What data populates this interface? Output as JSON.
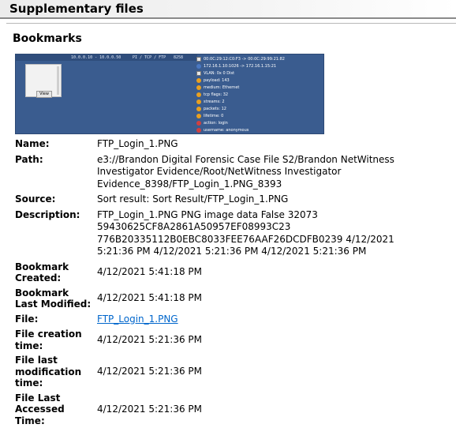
{
  "section": {
    "title": "Supplementary files"
  },
  "bookmarks": {
    "heading": "Bookmarks"
  },
  "thumbnail": {
    "top_texts": [
      "10.0.0.10 - 10.0.0.50",
      "PI / TCP / FTP",
      "8258"
    ],
    "button": "View",
    "rows": [
      {
        "color": "#e0e0e0",
        "text": "00:0C:29:12:C0:F3 -> 00:0C:29:99:21:82",
        "kind": "sq"
      },
      {
        "color": "#4a78c2",
        "text": "172.16.1.10:1026 -> 172.16.1.15:21",
        "kind": "dot"
      },
      {
        "color": "#e0e0e0",
        "text": "VLAN: 0x 0 Dist",
        "kind": "sq"
      },
      {
        "color": "#e8a020",
        "text": "payload: 143",
        "kind": "dot"
      },
      {
        "color": "#e8a020",
        "text": "medium: Ethernet",
        "kind": "dot"
      },
      {
        "color": "#e8a020",
        "text": "tcp flags: 32",
        "kind": "dot"
      },
      {
        "color": "#e8a020",
        "text": "streams: 2",
        "kind": "dot"
      },
      {
        "color": "#e8a020",
        "text": "packets: 12",
        "kind": "dot"
      },
      {
        "color": "#e8a020",
        "text": "lifetime: 0",
        "kind": "dot"
      },
      {
        "color": "#d04040",
        "text": "action: login",
        "kind": "dot"
      },
      {
        "color": "#d04040",
        "text": "username: anonymous",
        "kind": "dot"
      },
      {
        "color": "#d04040",
        "text": "password: mozilla@example.com",
        "kind": "dot"
      }
    ]
  },
  "properties": {
    "name": {
      "label": "Name:",
      "value": "FTP_Login_1.PNG"
    },
    "path": {
      "label": "Path:",
      "lines": [
        "e3://Brandon Digital Forensic Case File S2/Brandon NetWitness",
        "Investigator Evidence/Root/NetWitness Investigator",
        "Evidence_8398/FTP_Login_1.PNG_8393"
      ]
    },
    "source": {
      "label": "Source:",
      "value": "Sort result: Sort Result/FTP_Login_1.PNG"
    },
    "description": {
      "label": "Description:",
      "lines": [
        "FTP_Login_1.PNG PNG image data False 32073",
        "59430625CF8A2861A50957EF08993C23",
        "776B20335112B0EBC8033FEE76AAF26DCDFB0239 4/12/2021",
        "5:21:36 PM 4/12/2021 5:21:36 PM 4/12/2021 5:21:36 PM"
      ]
    },
    "bookmark_created": {
      "label_lines": [
        "Bookmark",
        "Created:"
      ],
      "value": "4/12/2021 5:41:18 PM"
    },
    "bookmark_modified": {
      "label_lines": [
        "Bookmark",
        "Last Modified:"
      ],
      "value": "4/12/2021 5:41:18 PM"
    },
    "file": {
      "label": "File:",
      "value": "FTP_Login_1.PNG"
    },
    "file_creation": {
      "label_lines": [
        "File creation",
        "time:"
      ],
      "value": "4/12/2021 5:21:36 PM"
    },
    "file_last_mod": {
      "label_lines": [
        "File last",
        "modification",
        "time:"
      ],
      "value": "4/12/2021 5:21:36 PM"
    },
    "file_last_access": {
      "label_lines": [
        "File Last",
        "Accessed",
        "Time:"
      ],
      "value": "4/12/2021 5:21:36 PM"
    }
  }
}
